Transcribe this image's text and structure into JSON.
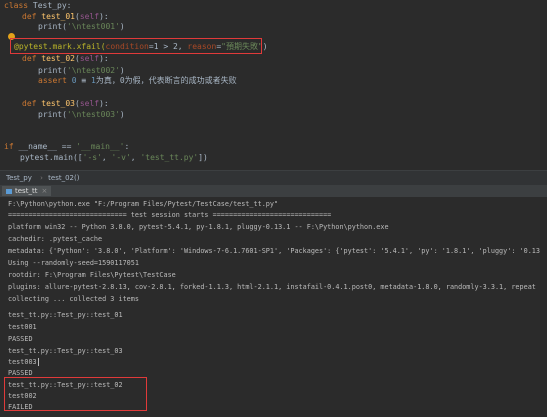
{
  "editor": {
    "l1": {
      "kw": "class",
      "name": "Test_py",
      "colon": ":"
    },
    "l2": {
      "kw": "def",
      "fn": "test_01",
      "open": "(",
      "self": "self",
      "close": "):"
    },
    "l3": {
      "call": "print(",
      "str": "'\\ntest001'",
      "close": ")"
    },
    "l4": {
      "deco": "@pytest.mark.xfail(",
      "p1": "condition",
      "eq1": "=1 > 2, ",
      "p2": "reason",
      "eq2": "=",
      "str": "\"預期失敗\"",
      "close": ")"
    },
    "l5": {
      "kw": "def",
      "fn": "test_02",
      "open": "(",
      "self": "self",
      "close": "):"
    },
    "l6": {
      "call": "print(",
      "str": "'\\ntest002'",
      "close": ")"
    },
    "l7": {
      "kw": "assert",
      "num0": "0",
      "mid": " ≡ ",
      "num1": "1",
      "comment": "为真，0为假，代表断言的成功或者失败"
    },
    "l8": {
      "kw": "def",
      "fn": "test_03",
      "open": "(",
      "self": "self",
      "close": "):"
    },
    "l9": {
      "call": "print(",
      "str": "'\\ntest003'",
      "close": ")"
    },
    "l10": {
      "kw": "if",
      "plain": " __name__ == ",
      "str": "'__main__'",
      "colon": ":"
    },
    "l11": {
      "plain": "pytest.main([",
      "s1": "'-s'",
      "c1": ", ",
      "s2": "'-v'",
      "c2": ", ",
      "s3": "'test_tt.py'",
      "close": "])"
    }
  },
  "breadcrumb": {
    "class": "Test_py",
    "sep": "›",
    "method": "test_02()"
  },
  "runbar": {
    "tab": "test_tt",
    "close": "×"
  },
  "console": {
    "lines": [
      "F:\\Python\\python.exe \"F:/Program Files/Pytest/TestCase/test_tt.py\"",
      "============================= test session starts =============================",
      "platform win32 -- Python 3.8.0, pytest-5.4.1, py-1.8.1, pluggy-0.13.1 -- F:\\Python\\python.exe",
      "cachedir: .pytest_cache",
      "metadata: {'Python': '3.8.0', 'Platform': 'Windows-7-6.1.7601-SP1', 'Packages': {'pytest': '5.4.1', 'py': '1.8.1', 'pluggy': '0.13",
      "Using --randomly-seed=1590117051",
      "rootdir: F:\\Program Files\\Pytest\\TestCase",
      "plugins: allure-pytest-2.8.13, cov-2.8.1, forked-1.1.3, html-2.1.1, instafail-0.4.1.post0, metadata-1.8.0, randomly-3.3.1, repeat",
      "collecting ... collected 3 items",
      "",
      "test_tt.py::Test_py::test_01",
      "test001",
      "PASSED",
      "test_tt.py::Test_py::test_03",
      "test003",
      "PASSED",
      "test_tt.py::Test_py::test_02",
      "test002",
      "FAILED"
    ]
  }
}
